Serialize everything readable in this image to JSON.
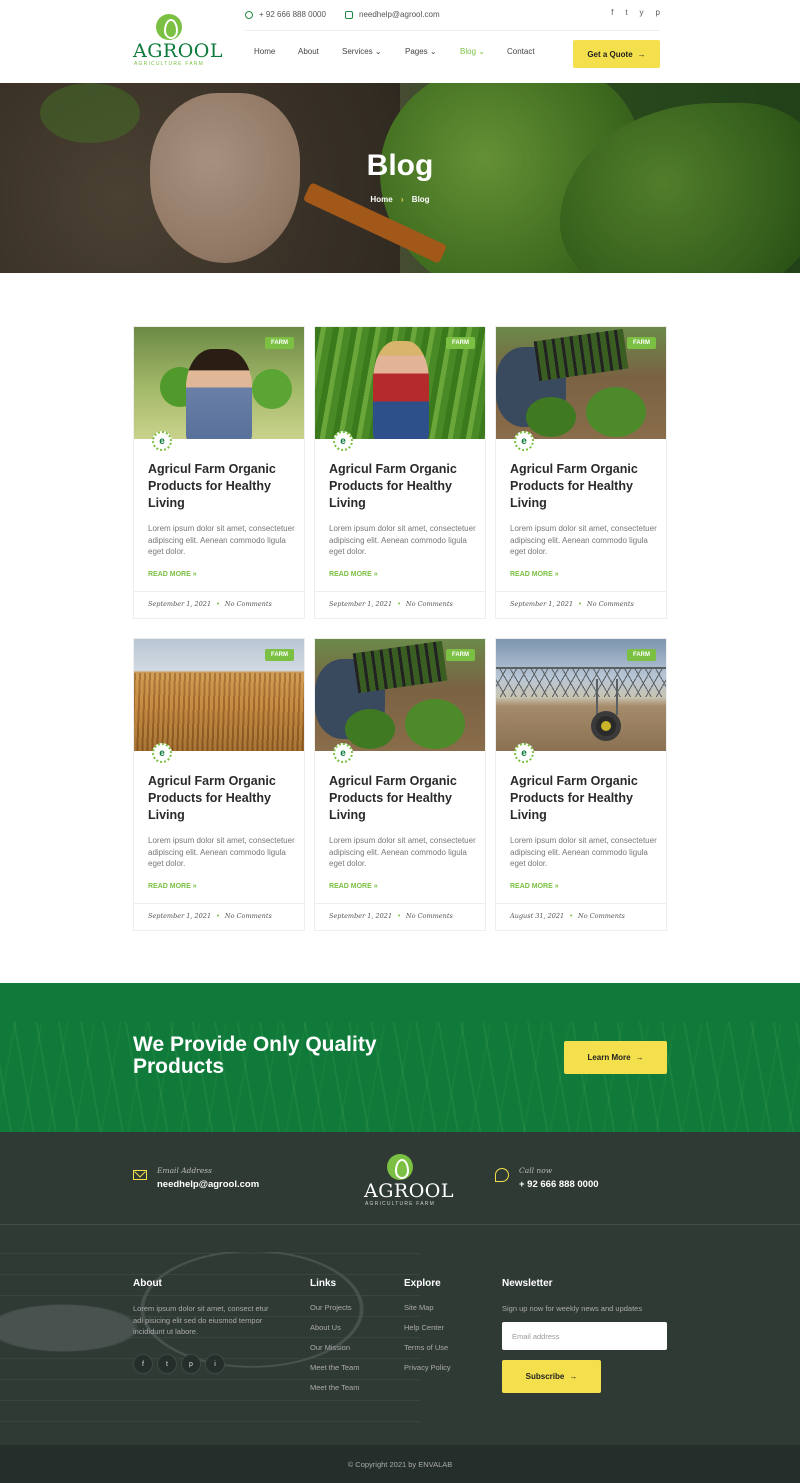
{
  "brand": {
    "name": "AGROOL",
    "tagline": "AGRICULTURE FARM"
  },
  "topbar": {
    "phone": "+ 92 666 888 0000",
    "email": "needhelp@agrool.com",
    "socials": [
      "f",
      "t",
      "y",
      "p"
    ]
  },
  "nav": {
    "items": [
      "Home",
      "About",
      "Services",
      "Pages",
      "Blog",
      "Contact"
    ],
    "active": "Blog",
    "quote_label": "Get a Quote"
  },
  "hero": {
    "title": "Blog",
    "breadcrumb": [
      "Home",
      "Blog"
    ]
  },
  "posts": [
    {
      "tag": "FARM",
      "title": "Agricul Farm Organic Products for Healthy Living",
      "excerpt": "Lorem ipsum dolor sit amet, consectetuer adipiscing elit. Aenean commodo ligula eget dolor.",
      "more": "READ MORE »",
      "date": "September 1, 2021",
      "comments": "No Comments"
    },
    {
      "tag": "FARM",
      "title": "Agricul Farm Organic Products for Healthy Living",
      "excerpt": "Lorem ipsum dolor sit amet, consectetuer adipiscing elit. Aenean commodo ligula eget dolor.",
      "more": "READ MORE »",
      "date": "September 1, 2021",
      "comments": "No Comments"
    },
    {
      "tag": "FARM",
      "title": "Agricul Farm Organic Products for Healthy Living",
      "excerpt": "Lorem ipsum dolor sit amet, consectetuer adipiscing elit. Aenean commodo ligula eget dolor.",
      "more": "READ MORE »",
      "date": "September 1, 2021",
      "comments": "No Comments"
    },
    {
      "tag": "FARM",
      "title": "Agricul Farm Organic Products for Healthy Living",
      "excerpt": "Lorem ipsum dolor sit amet, consectetuer adipiscing elit. Aenean commodo ligula eget dolor.",
      "more": "READ MORE »",
      "date": "September 1, 2021",
      "comments": "No Comments"
    },
    {
      "tag": "FARM",
      "title": "Agricul Farm Organic Products for Healthy Living",
      "excerpt": "Lorem ipsum dolor sit amet, consectetuer adipiscing elit. Aenean commodo ligula eget dolor.",
      "more": "READ MORE »",
      "date": "September 1, 2021",
      "comments": "No Comments"
    },
    {
      "tag": "FARM",
      "title": "Agricul Farm Organic Products for Healthy Living",
      "excerpt": "Lorem ipsum dolor sit amet, consectetuer adipiscing elit. Aenean commodo ligula eget dolor.",
      "more": "READ MORE »",
      "date": "August 31, 2021",
      "comments": "No Comments"
    }
  ],
  "cta": {
    "title": "We Provide Only Quality Products",
    "button": "Learn More"
  },
  "footer": {
    "email_label": "Email Address",
    "email": "needhelp@agrool.com",
    "call_label": "Call now",
    "phone": "+ 92 666 888 0000",
    "about_title": "About",
    "about_text": "Lorem ipsum dolor sit amet, consect etur adi pisicing elit sed do eiusmod tempor incididunt ut labore.",
    "about_socials": [
      "f",
      "t",
      "p",
      "i"
    ],
    "links_title": "Links",
    "links": [
      "Our Projects",
      "About Us",
      "Our Mission",
      "Meet the Team",
      "Meet the Team"
    ],
    "explore_title": "Explore",
    "explore": [
      "Site Map",
      "Help Center",
      "Terms of Use",
      "Privacy Policy"
    ],
    "newsletter_title": "Newsletter",
    "newsletter_text": "Sign up now for weekly news and updates",
    "newsletter_placeholder": "Email address",
    "subscribe": "Subscribe",
    "copyright": "© Copyright 2021 by ENVALAB"
  },
  "colors": {
    "primary": "#0f7a3a",
    "accent": "#7bc043",
    "button": "#f4e04d",
    "footer": "#303a35"
  }
}
